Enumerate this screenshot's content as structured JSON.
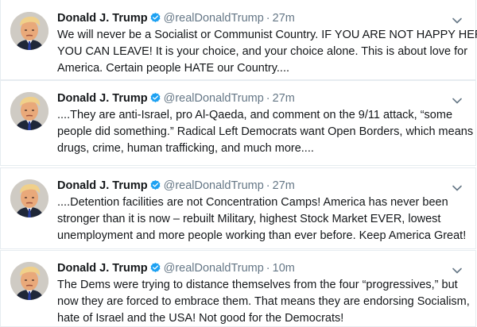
{
  "tweets": [
    {
      "name": "Donald J. Trump",
      "handle": "@realDonaldTrump",
      "separator": "·",
      "time": "27m",
      "lines": [
        "We will never be a Socialist or Communist Country. IF YOU ARE NOT HAPPY HERE,",
        "YOU CAN LEAVE! It is your choice, and your choice alone. This is about love for",
        "America. Certain people HATE our Country...."
      ]
    },
    {
      "name": "Donald J. Trump",
      "handle": "@realDonaldTrump",
      "separator": "·",
      "time": "27m",
      "lines": [
        "....They are anti-Israel, pro Al-Qaeda, and comment on the 9/11 attack, “some",
        "people did something.” Radical Left Democrats want Open Borders, which means",
        "drugs, crime, human trafficking, and much more...."
      ]
    },
    {
      "name": "Donald J. Trump",
      "handle": "@realDonaldTrump",
      "separator": "·",
      "time": "27m",
      "lines": [
        "....Detention facilities are not Concentration Camps! America has never been",
        "stronger than it is now – rebuilt Military, highest Stock Market EVER, lowest",
        "unemployment and more people working than ever before. Keep America Great!"
      ]
    },
    {
      "name": "Donald J. Trump",
      "handle": "@realDonaldTrump",
      "separator": "·",
      "time": "10m",
      "lines": [
        "The Dems were trying to distance themselves from the four “progressives,” but",
        "now they are forced to embrace them. That means they are endorsing Socialism,",
        "hate of Israel and the USA! Not good for the Democrats!"
      ]
    }
  ],
  "icons": {
    "avatar": "profile-photo",
    "verified": "verified-badge-icon",
    "menu": "chevron-down-icon"
  },
  "colors": {
    "text": "#14171a",
    "secondary": "#657786",
    "verified": "#1da1f2",
    "border": "#e6ecf0"
  }
}
